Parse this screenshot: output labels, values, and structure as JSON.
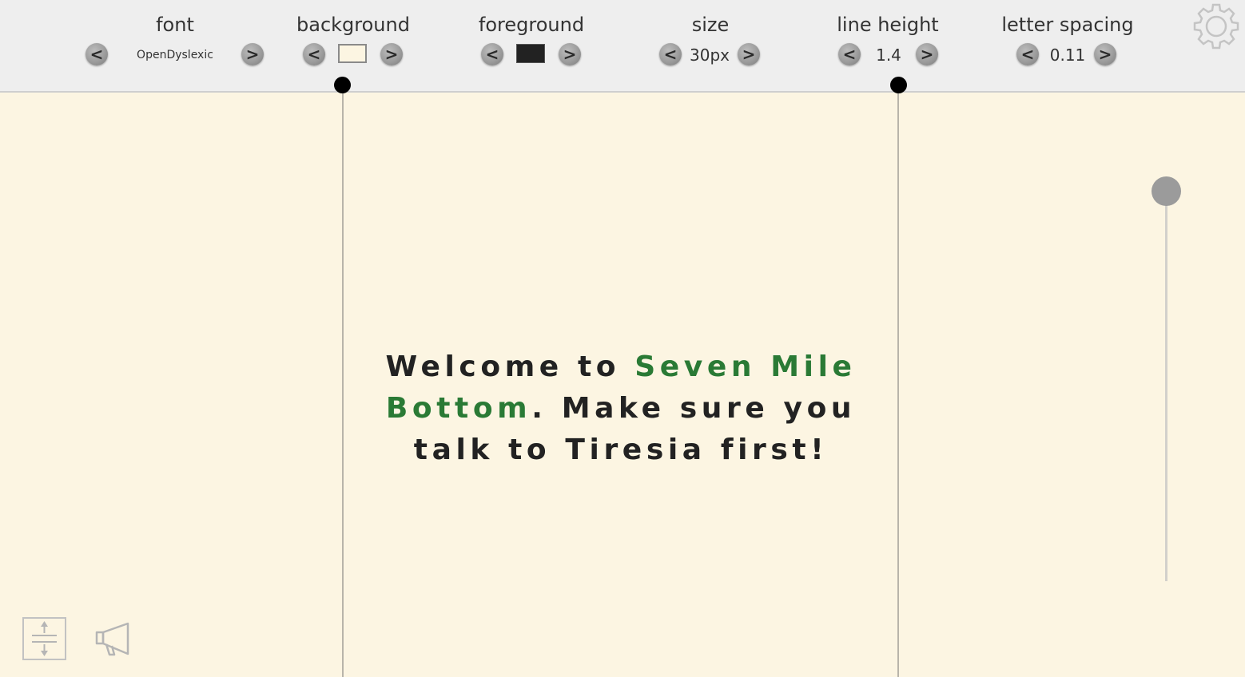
{
  "toolbar": {
    "font": {
      "title": "font",
      "value": "OpenDyslexic"
    },
    "background": {
      "title": "background",
      "swatch_color": "#fcf5e2"
    },
    "foreground": {
      "title": "foreground",
      "swatch_color": "#222222"
    },
    "size": {
      "title": "size",
      "value": "30px"
    },
    "line_height": {
      "title": "line height",
      "value": "1.4"
    },
    "letter_spacing": {
      "title": "letter spacing",
      "value": "0.11"
    },
    "prev_glyph": "<",
    "next_glyph": ">"
  },
  "content": {
    "part1": "Welcome to ",
    "highlight": "Seven Mile Bottom",
    "part2": ". Make sure you talk to Tiresia first!"
  },
  "scroll": {
    "position": 0
  },
  "colors": {
    "background": "#fcf5e2",
    "toolbar": "#eeeeee",
    "text": "#222222",
    "highlight": "#2a7a35",
    "handle": "#000000"
  },
  "icons": {
    "settings": "gear-icon",
    "spacing": "vertical-spacing-icon",
    "speak": "megaphone-icon"
  }
}
